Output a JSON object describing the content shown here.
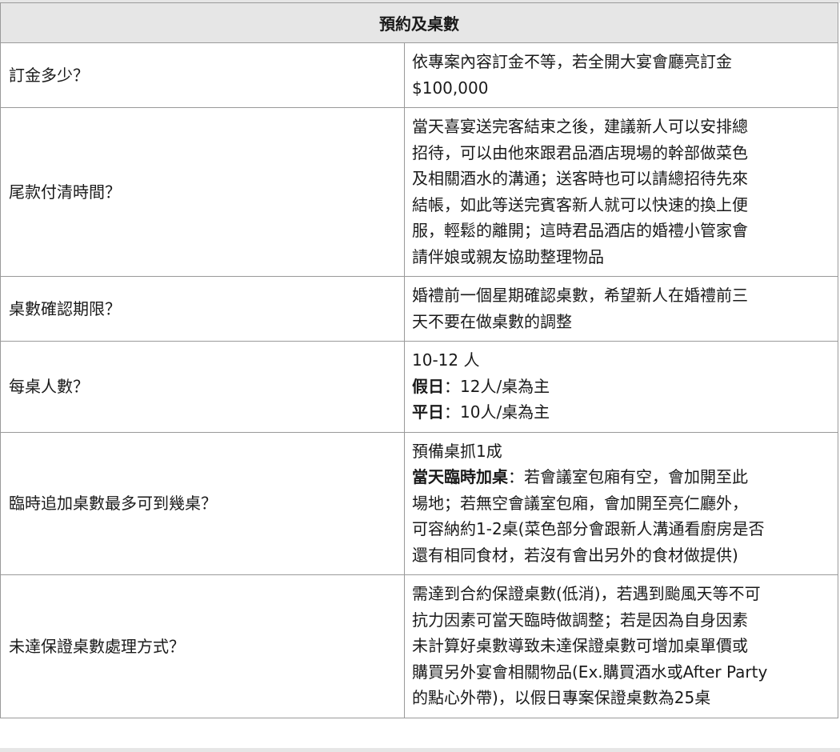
{
  "section_title": "預約及桌數",
  "rows": [
    {
      "question": "訂金多少？",
      "answer_lines": [
        {
          "text": "依專案內容訂金不等，若全開大宴會廳亮訂金"
        },
        {
          "text": "$100,000"
        }
      ]
    },
    {
      "question": "尾款付清時間？",
      "answer_lines": [
        {
          "text": "當天喜宴送完客結束之後，建議新人可以安排總"
        },
        {
          "text": "招待，可以由他來跟君品酒店現場的幹部做菜色"
        },
        {
          "text": "及相關酒水的溝通；送客時也可以請總招待先來"
        },
        {
          "text": "結帳，如此等送完賓客新人就可以快速的換上便"
        },
        {
          "text": "服，輕鬆的離開；這時君品酒店的婚禮小管家會"
        },
        {
          "text": "請伴娘或親友協助整理物品"
        }
      ]
    },
    {
      "question": "桌數確認期限？",
      "answer_lines": [
        {
          "text": "婚禮前一個星期確認桌數，希望新人在婚禮前三"
        },
        {
          "text": "天不要在做桌數的調整"
        }
      ]
    },
    {
      "question": "每桌人數？",
      "answer_lines": [
        {
          "text": "10-12 人"
        },
        {
          "bold": "假日",
          "text": "：12人/桌為主"
        },
        {
          "bold": "平日",
          "text": "：10人/桌為主"
        }
      ]
    },
    {
      "question": "臨時追加桌數最多可到幾桌？",
      "answer_lines": [
        {
          "text": "預備桌抓1成"
        },
        {
          "bold": "當天臨時加桌",
          "text": "：若會議室包廂有空，會加開至此"
        },
        {
          "text": "場地；若無空會議室包廂，會加開至亮仁廳外，"
        },
        {
          "text": "可容納約1-2桌(菜色部分會跟新人溝通看廚房是否"
        },
        {
          "text": "還有相同食材，若沒有會出另外的食材做提供)"
        }
      ]
    },
    {
      "question": "未達保證桌數處理方式？",
      "answer_lines": [
        {
          "text": "需達到合約保證桌數(低消)，若遇到颱風天等不可"
        },
        {
          "text": "抗力因素可當天臨時做調整；若是因為自身因素"
        },
        {
          "text": "未計算好桌數導致未達保證桌數可增加桌單價或"
        },
        {
          "text": "購買另外宴會相關物品(Ex.購買酒水或After Party"
        },
        {
          "text": "的點心外帶)，以假日專案保證桌數為25桌"
        }
      ]
    }
  ]
}
